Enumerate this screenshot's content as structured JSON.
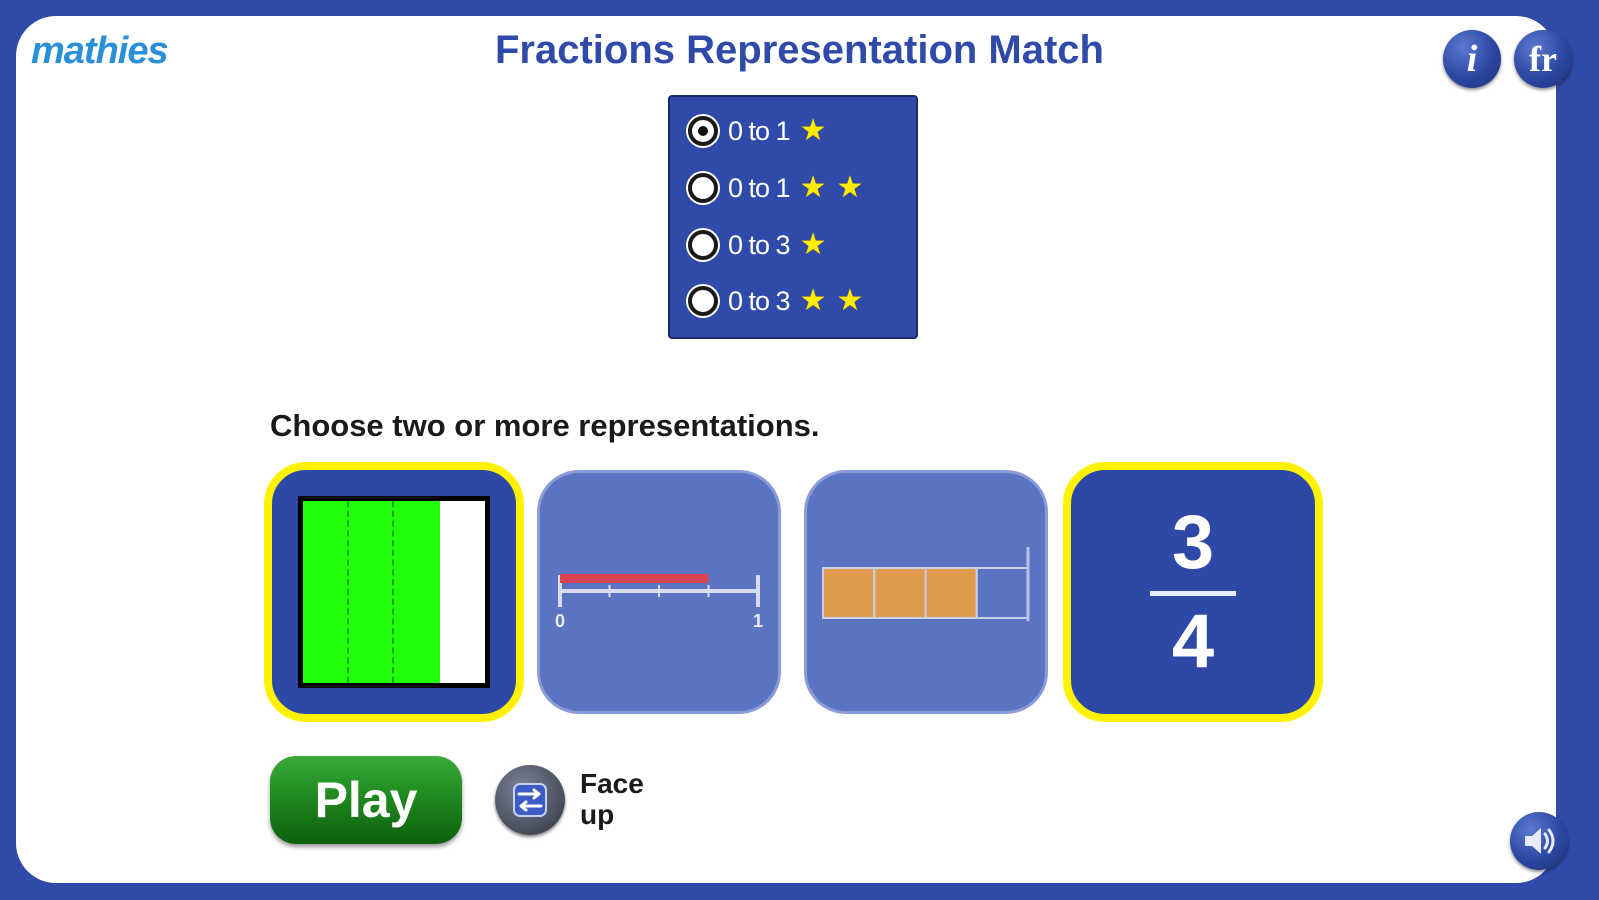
{
  "app": {
    "logo": "mathies",
    "title": "Fractions Representation Match",
    "info_button": "i",
    "language_button": "fr"
  },
  "levels": [
    {
      "label": "0 to 1",
      "stars": 1,
      "selected": true
    },
    {
      "label": "0 to 1",
      "stars": 2,
      "selected": false
    },
    {
      "label": "0 to 3",
      "stars": 1,
      "selected": false
    },
    {
      "label": "0 to 3",
      "stars": 2,
      "selected": false
    }
  ],
  "instruction": "Choose two or more representations.",
  "fraction": {
    "numerator": 3,
    "denominator": 4,
    "value": 0.75
  },
  "cards": {
    "area_model": {
      "selected": true,
      "filled_parts": 3,
      "total_parts": 4
    },
    "number_line": {
      "selected": false,
      "min_label": "0",
      "max_label": "1",
      "value": 0.75
    },
    "strip_model": {
      "selected": false,
      "filled_parts": 3,
      "total_parts": 4
    },
    "fraction_symbol": {
      "selected": true,
      "numerator": "3",
      "denominator": "4"
    }
  },
  "controls": {
    "play_label": "Play",
    "face_up_line1": "Face",
    "face_up_line2": "up"
  },
  "colors": {
    "brand_blue": "#2f4aa8",
    "selected_border": "#fff200",
    "area_fill": "#22ff0a",
    "number_line_bar": "#d9434f",
    "strip_fill": "#e09a4e",
    "play_green": "#1f8a1f",
    "star": "#ffeb00"
  },
  "icons": [
    "info-icon",
    "french-language-icon",
    "swap-arrows-icon",
    "speaker-icon",
    "star-icon"
  ]
}
